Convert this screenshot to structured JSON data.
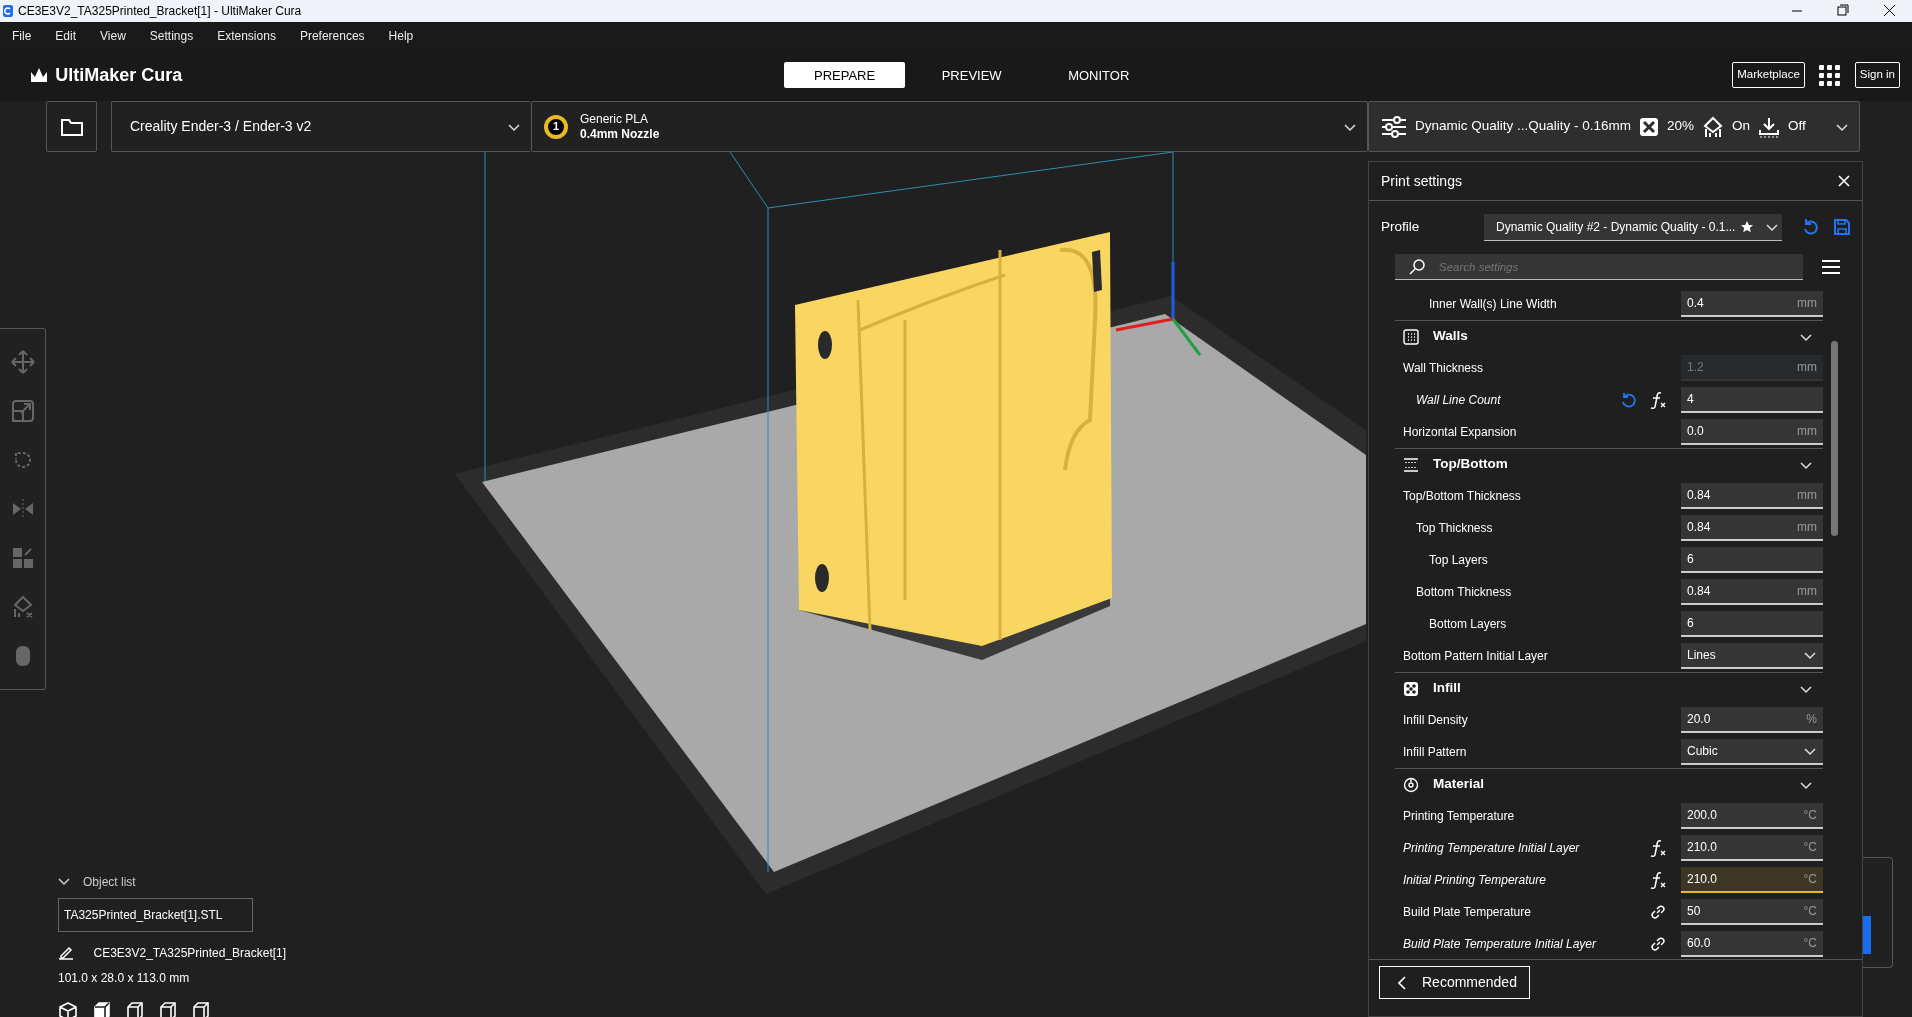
{
  "window": {
    "title": "CE3E3V2_TA325Printed_Bracket[1] - UltiMaker Cura"
  },
  "menu": [
    "File",
    "Edit",
    "View",
    "Settings",
    "Extensions",
    "Preferences",
    "Help"
  ],
  "header": {
    "logo": "UltiMaker Cura",
    "stages": [
      {
        "label": "PREPARE",
        "selected": true
      },
      {
        "label": "PREVIEW",
        "selected": false
      },
      {
        "label": "MONITOR",
        "selected": false
      }
    ],
    "marketplace": "Marketplace",
    "sign_in": "Sign in"
  },
  "printer": {
    "name": "Creality Ender-3 / Ender-3 v2"
  },
  "extruder": {
    "number": "1",
    "material": "Generic PLA",
    "nozzle": "0.4mm Nozzle"
  },
  "print_setup": {
    "profile": "Dynamic Quality ...Quality - 0.16mm",
    "infill": "20%",
    "support": "On",
    "adhesion": "Off"
  },
  "print_settings": {
    "title": "Print settings",
    "profile_label": "Profile",
    "profile_name": "Dynamic Quality #2",
    "profile_detail": " - Dynamic Quality - 0.1...",
    "search": {
      "placeholder": "Search settings"
    },
    "settings": [
      {
        "kind": "group",
        "children": [
          {
            "kind": "group",
            "children": [
              {
                "kind": "number",
                "label": "Inner Wall(s) Line Width",
                "value": "0.4",
                "unit": "mm",
                "overridden": false,
                "disabled": false,
                "warning": false,
                "reset": false,
                "formula": false,
                "linked": false
              }
            ]
          }
        ]
      },
      {
        "kind": "category",
        "label": "Walls",
        "expanded": true,
        "children": [
          {
            "kind": "number",
            "label": "Wall Thickness",
            "value": "1.2",
            "unit": "mm",
            "overridden": false,
            "disabled": true,
            "warning": false,
            "reset": false,
            "formula": false,
            "linked": false,
            "children": [
              {
                "kind": "number",
                "label": "Wall Line Count",
                "value": "4",
                "overridden": true,
                "disabled": false,
                "warning": false,
                "reset": true,
                "formula": true,
                "linked": false
              }
            ]
          },
          {
            "kind": "number",
            "label": "Horizontal Expansion",
            "value": "0.0",
            "unit": "mm",
            "overridden": false,
            "disabled": false,
            "warning": false,
            "reset": false,
            "formula": false,
            "linked": false
          }
        ]
      },
      {
        "kind": "category",
        "label": "Top/Bottom",
        "expanded": true,
        "children": [
          {
            "kind": "number",
            "label": "Top/Bottom Thickness",
            "value": "0.84",
            "unit": "mm",
            "overridden": false,
            "disabled": false,
            "warning": false,
            "reset": false,
            "formula": false,
            "linked": false,
            "children": [
              {
                "kind": "number",
                "label": "Top Thickness",
                "value": "0.84",
                "unit": "mm",
                "overridden": false,
                "disabled": false,
                "warning": false,
                "reset": false,
                "formula": false,
                "linked": false,
                "children": [
                  {
                    "kind": "number",
                    "label": "Top Layers",
                    "value": "6",
                    "overridden": false,
                    "disabled": false,
                    "warning": false,
                    "reset": false,
                    "formula": false,
                    "linked": false
                  }
                ]
              },
              {
                "kind": "number",
                "label": "Bottom Thickness",
                "value": "0.84",
                "unit": "mm",
                "overridden": false,
                "disabled": false,
                "warning": false,
                "reset": false,
                "formula": false,
                "linked": false,
                "children": [
                  {
                    "kind": "number",
                    "label": "Bottom Layers",
                    "value": "6",
                    "overridden": false,
                    "disabled": false,
                    "warning": false,
                    "reset": false,
                    "formula": false,
                    "linked": false
                  }
                ]
              }
            ]
          },
          {
            "kind": "dropdown",
            "label": "Bottom Pattern Initial Layer",
            "value": "Lines",
            "overridden": false,
            "disabled": false,
            "warning": false,
            "reset": false,
            "formula": false,
            "linked": false
          }
        ]
      },
      {
        "kind": "category",
        "label": "Infill",
        "expanded": true,
        "children": [
          {
            "kind": "number",
            "label": "Infill Density",
            "value": "20.0",
            "unit": "%",
            "overridden": false,
            "disabled": false,
            "warning": false,
            "reset": false,
            "formula": false,
            "linked": false
          },
          {
            "kind": "dropdown",
            "label": "Infill Pattern",
            "value": "Cubic",
            "overridden": false,
            "disabled": false,
            "warning": false,
            "reset": false,
            "formula": false,
            "linked": false
          }
        ]
      },
      {
        "kind": "category",
        "label": "Material",
        "expanded": true,
        "children": [
          {
            "kind": "number",
            "label": "Printing Temperature",
            "value": "200.0",
            "unit": "°C",
            "overridden": false,
            "disabled": false,
            "warning": false,
            "reset": false,
            "formula": false,
            "linked": false
          },
          {
            "kind": "number",
            "label": "Printing Temperature Initial Layer",
            "value": "210.0",
            "unit": "°C",
            "overridden": true,
            "disabled": false,
            "warning": false,
            "reset": false,
            "formula": true,
            "linked": false
          },
          {
            "kind": "number",
            "label": "Initial Printing Temperature",
            "value": "210.0",
            "unit": "°C",
            "overridden": true,
            "disabled": false,
            "warning": true,
            "reset": false,
            "formula": true,
            "linked": false
          },
          {
            "kind": "number",
            "label": "Build Plate Temperature",
            "value": "50",
            "unit": "°C",
            "overridden": false,
            "disabled": false,
            "warning": false,
            "reset": false,
            "formula": false,
            "linked": true
          },
          {
            "kind": "number",
            "label": "Build Plate Temperature Initial Layer",
            "value": "60.0",
            "unit": "°C",
            "overridden": true,
            "disabled": false,
            "warning": false,
            "reset": false,
            "formula": false,
            "linked": true
          }
        ]
      }
    ],
    "recommended_button": "Recommended"
  },
  "object_list": {
    "label": "Object list",
    "expanded": true,
    "items": [
      "TA325Printed_Bracket[1].STL"
    ],
    "object_name": "CE3E3V2_TA325Printed_Bracket[1]",
    "dimensions": "101.0 x 28.0 x 113.0 mm"
  }
}
